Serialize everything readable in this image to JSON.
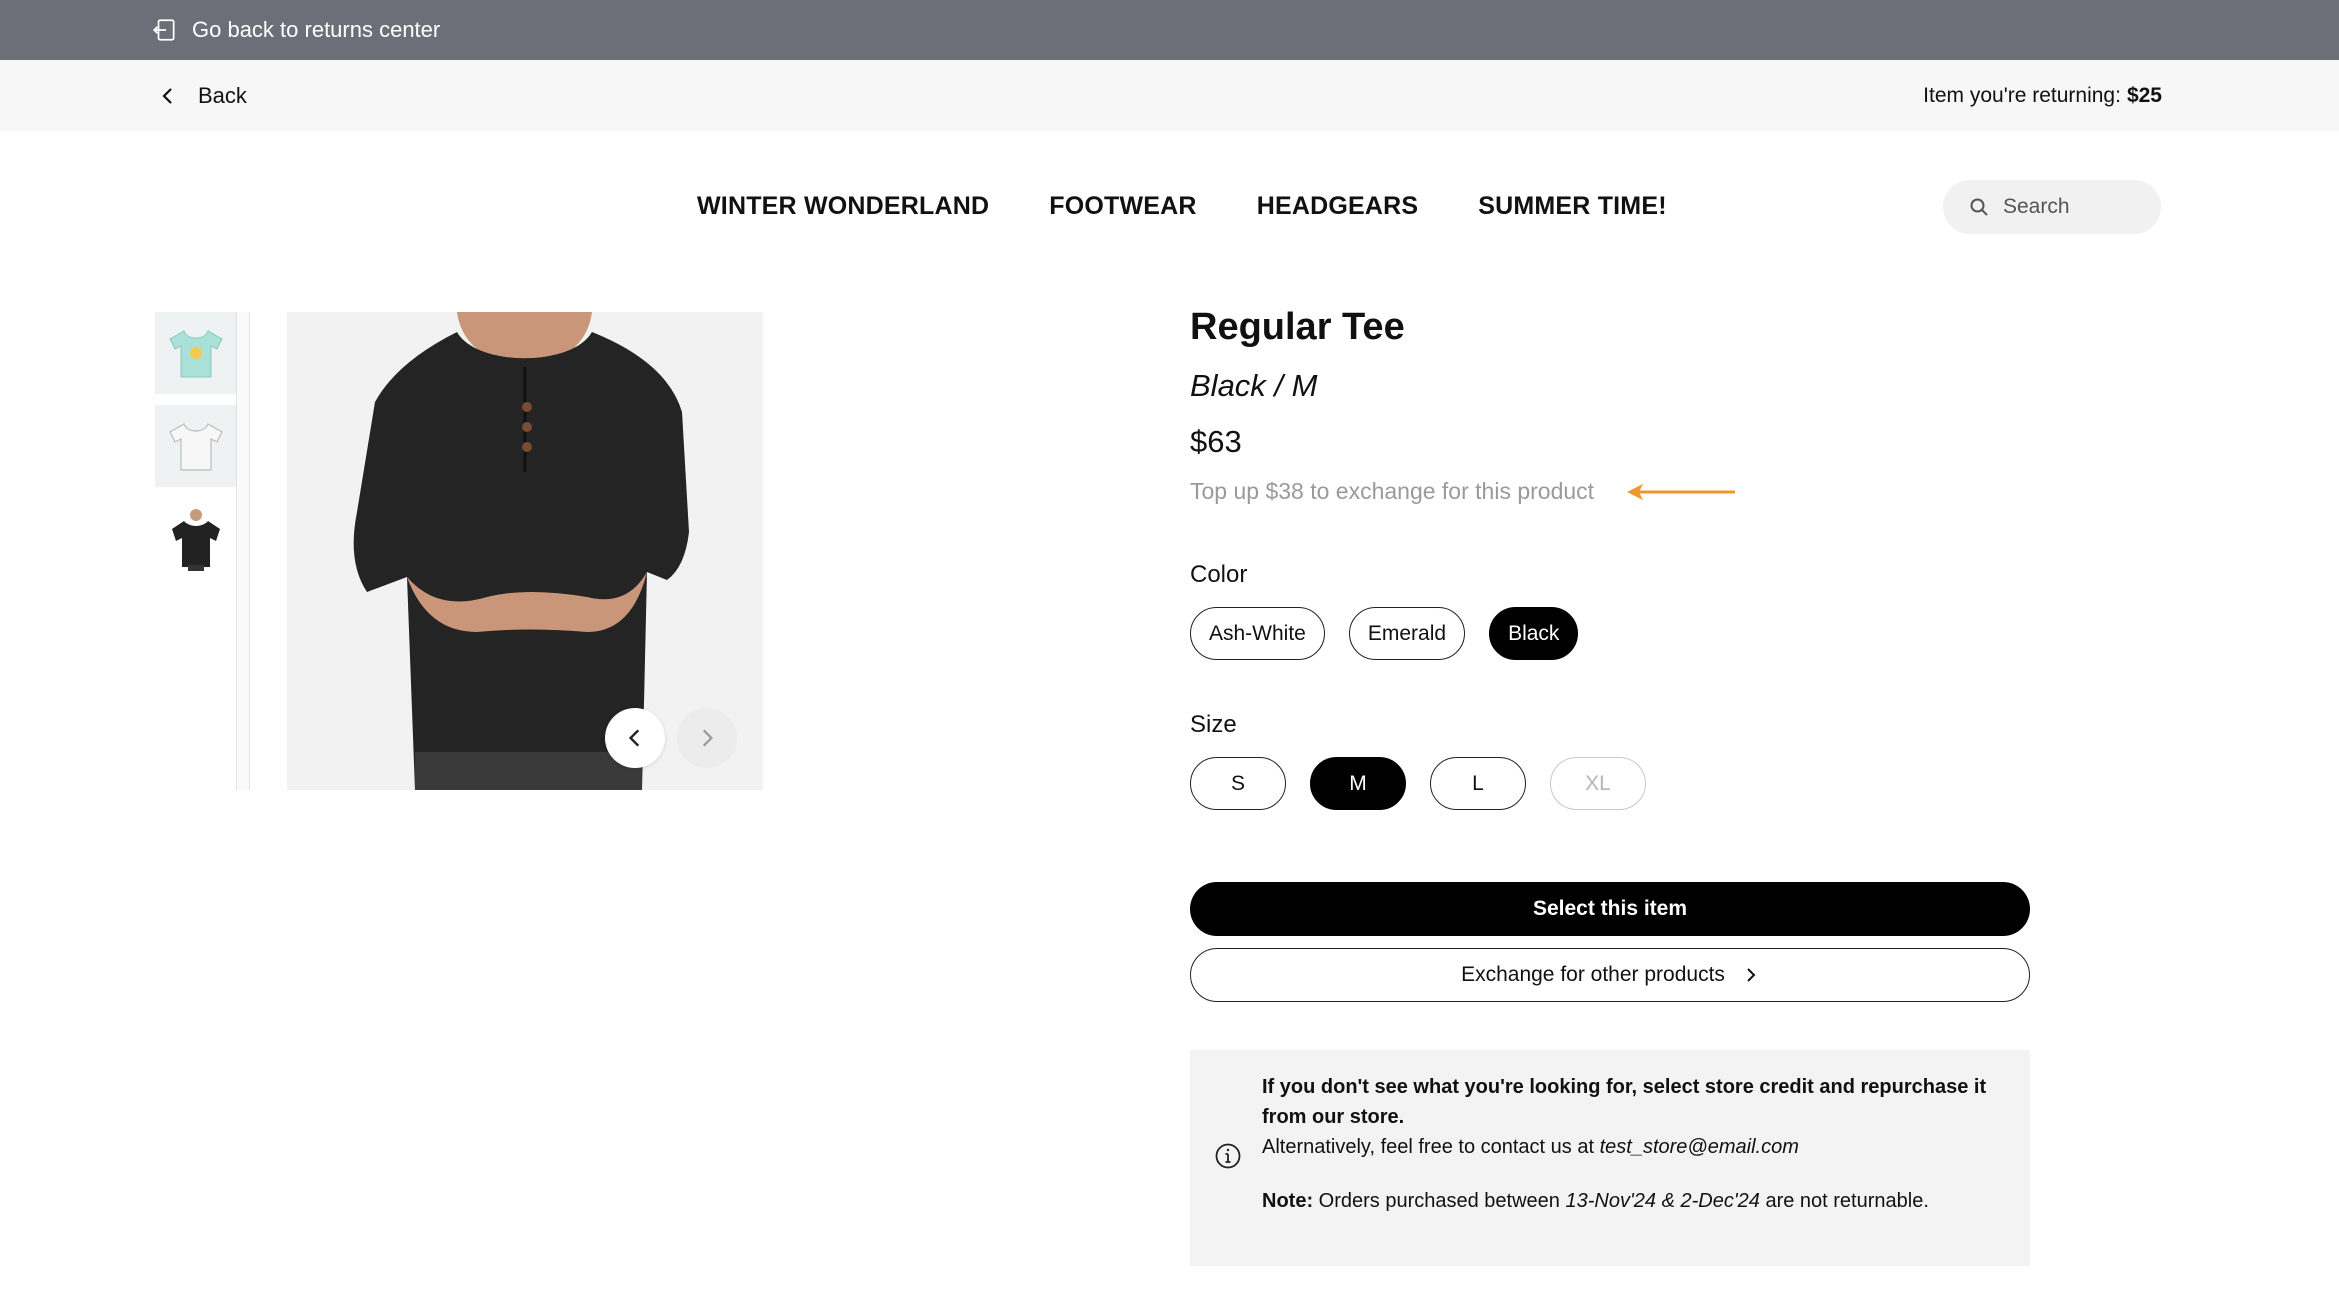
{
  "topbar": {
    "back_to_center": "Go back to returns center"
  },
  "subbar": {
    "back": "Back",
    "returning_label": "Item you're returning:",
    "returning_value": "$25"
  },
  "nav": {
    "items": [
      "WINTER WONDERLAND",
      "FOOTWEAR",
      "HEADGEARS",
      "SUMMER TIME!"
    ]
  },
  "search": {
    "placeholder": "Search"
  },
  "gallery": {
    "thumbnails": [
      "mint-tshirt",
      "white-tshirt",
      "black-henley-tee"
    ],
    "selected_index": 2
  },
  "product": {
    "title": "Regular Tee",
    "variant": "Black / M",
    "price": "$63",
    "topup_note": "Top up $38 to exchange for this product"
  },
  "color": {
    "label": "Color",
    "options": [
      "Ash-White",
      "Emerald",
      "Black"
    ],
    "selected": "Black"
  },
  "size": {
    "label": "Size",
    "options": [
      "S",
      "M",
      "L",
      "XL"
    ],
    "selected": "M",
    "unavailable": [
      "XL"
    ]
  },
  "actions": {
    "select": "Select this item",
    "exchange": "Exchange for other products"
  },
  "notice": {
    "headline": "If you don't see what you're looking for, select store credit and repurchase it from our store.",
    "contact_prefix": "Alternatively, feel free to contact us at",
    "contact_email": "test_store@email.com",
    "note_label": "Note:",
    "note_prefix": "Orders purchased between",
    "note_dates": "13-Nov'24 & 2-Dec'24",
    "note_suffix": "are not returnable."
  },
  "colors": {
    "topbar_bg": "#6d6e78",
    "accent_arrow": "#f0962e",
    "primary": "#000000"
  }
}
